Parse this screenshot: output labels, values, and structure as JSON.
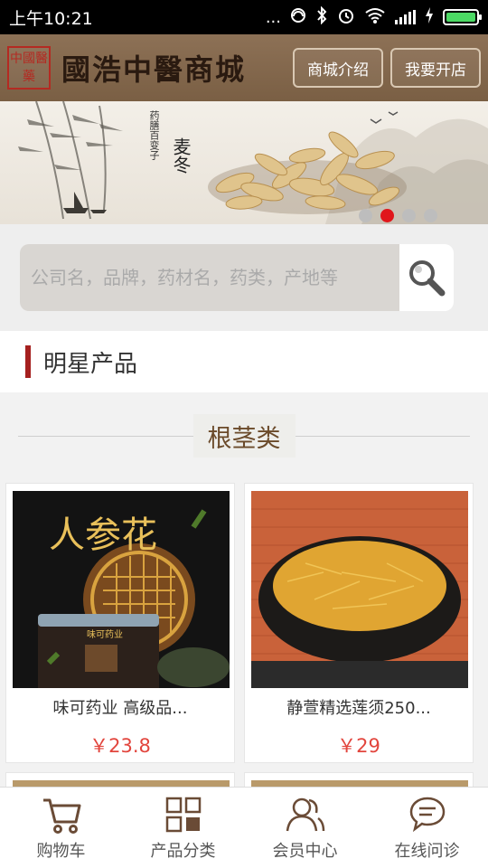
{
  "status_bar": {
    "time": "上午10:21",
    "dots": "...",
    "colors": {
      "battery": "#4cd964"
    }
  },
  "header": {
    "seal_text": "中國醫藥",
    "title": "國浩中醫商城",
    "buttons": [
      {
        "label": "商城介绍"
      },
      {
        "label": "我要开店"
      }
    ],
    "colors": {
      "background": "#7a5f44",
      "seal": "#b42a22"
    }
  },
  "banner": {
    "vertical_caption": "药膳百变子",
    "product_name": "麦冬",
    "slide_count": 4,
    "active_slide_index": 1,
    "colors": {
      "active_dot": "#e0161b",
      "dot": "#bdbdbd"
    }
  },
  "search": {
    "placeholder": "公司名，品牌，药材名，药类，产地等",
    "icon": "search-icon"
  },
  "section": {
    "title": "明星产品",
    "accent_color": "#a5201f"
  },
  "category": {
    "name": "根茎类"
  },
  "products": [
    {
      "title": "味可药业 高级品...",
      "price": "￥23.8",
      "image_text": "人参花",
      "jar_label": "味可药业"
    },
    {
      "title": "静萱精选莲须250...",
      "price": "￥29"
    }
  ],
  "bottom_nav": [
    {
      "label": "购物车",
      "icon": "cart-icon"
    },
    {
      "label": "产品分类",
      "icon": "grid-icon"
    },
    {
      "label": "会员中心",
      "icon": "users-icon"
    },
    {
      "label": "在线问诊",
      "icon": "chat-icon"
    }
  ],
  "price_color": "#e2453d"
}
